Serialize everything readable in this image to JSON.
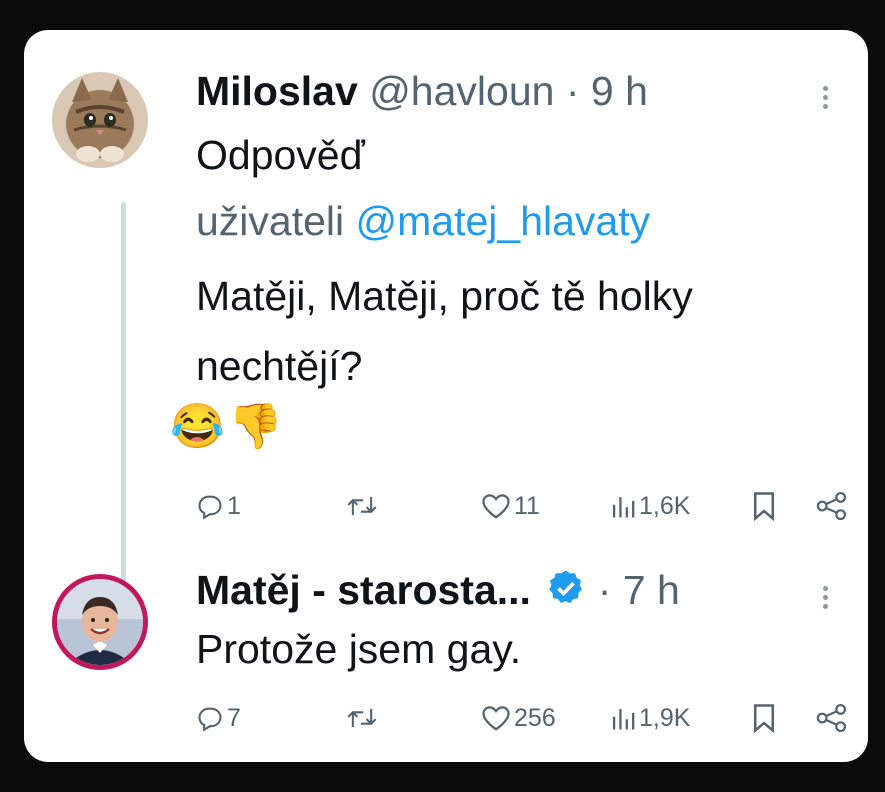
{
  "tweets": [
    {
      "name": "Miloslav",
      "handle": "@havloun",
      "dot": "·",
      "time": "9 h",
      "reply_prefix": "Odpověď",
      "reply_to_word": "uživateli",
      "reply_to_handle": "@matej_hlavaty",
      "text_line1": "Matěji, Matěji, proč tě holky",
      "text_line2": "nechtějí?",
      "emojis": [
        "😂",
        "👎"
      ],
      "replies": "1",
      "retweets": "",
      "likes": "11",
      "views": "1,6K"
    },
    {
      "name": "Matěj - starosta...",
      "dot": "·",
      "time": "7 h",
      "text": "Protože jsem gay.",
      "replies": "7",
      "retweets": "",
      "likes": "256",
      "views": "1,9K",
      "verified_color": "#1d9bf0"
    }
  ],
  "icons": {
    "reply": "reply-icon",
    "retweet": "retweet-icon",
    "like": "heart-icon",
    "views": "views-icon",
    "bookmark": "bookmark-icon",
    "share": "share-icon",
    "more": "more-icon"
  },
  "colors": {
    "background": "#0b0b0b",
    "card": "#ffffff",
    "text": "#0f1419",
    "muted": "#536471",
    "link": "#1d9bf0",
    "thread_line": "#cfd9de",
    "avatar2_ring": "#c2185b"
  }
}
